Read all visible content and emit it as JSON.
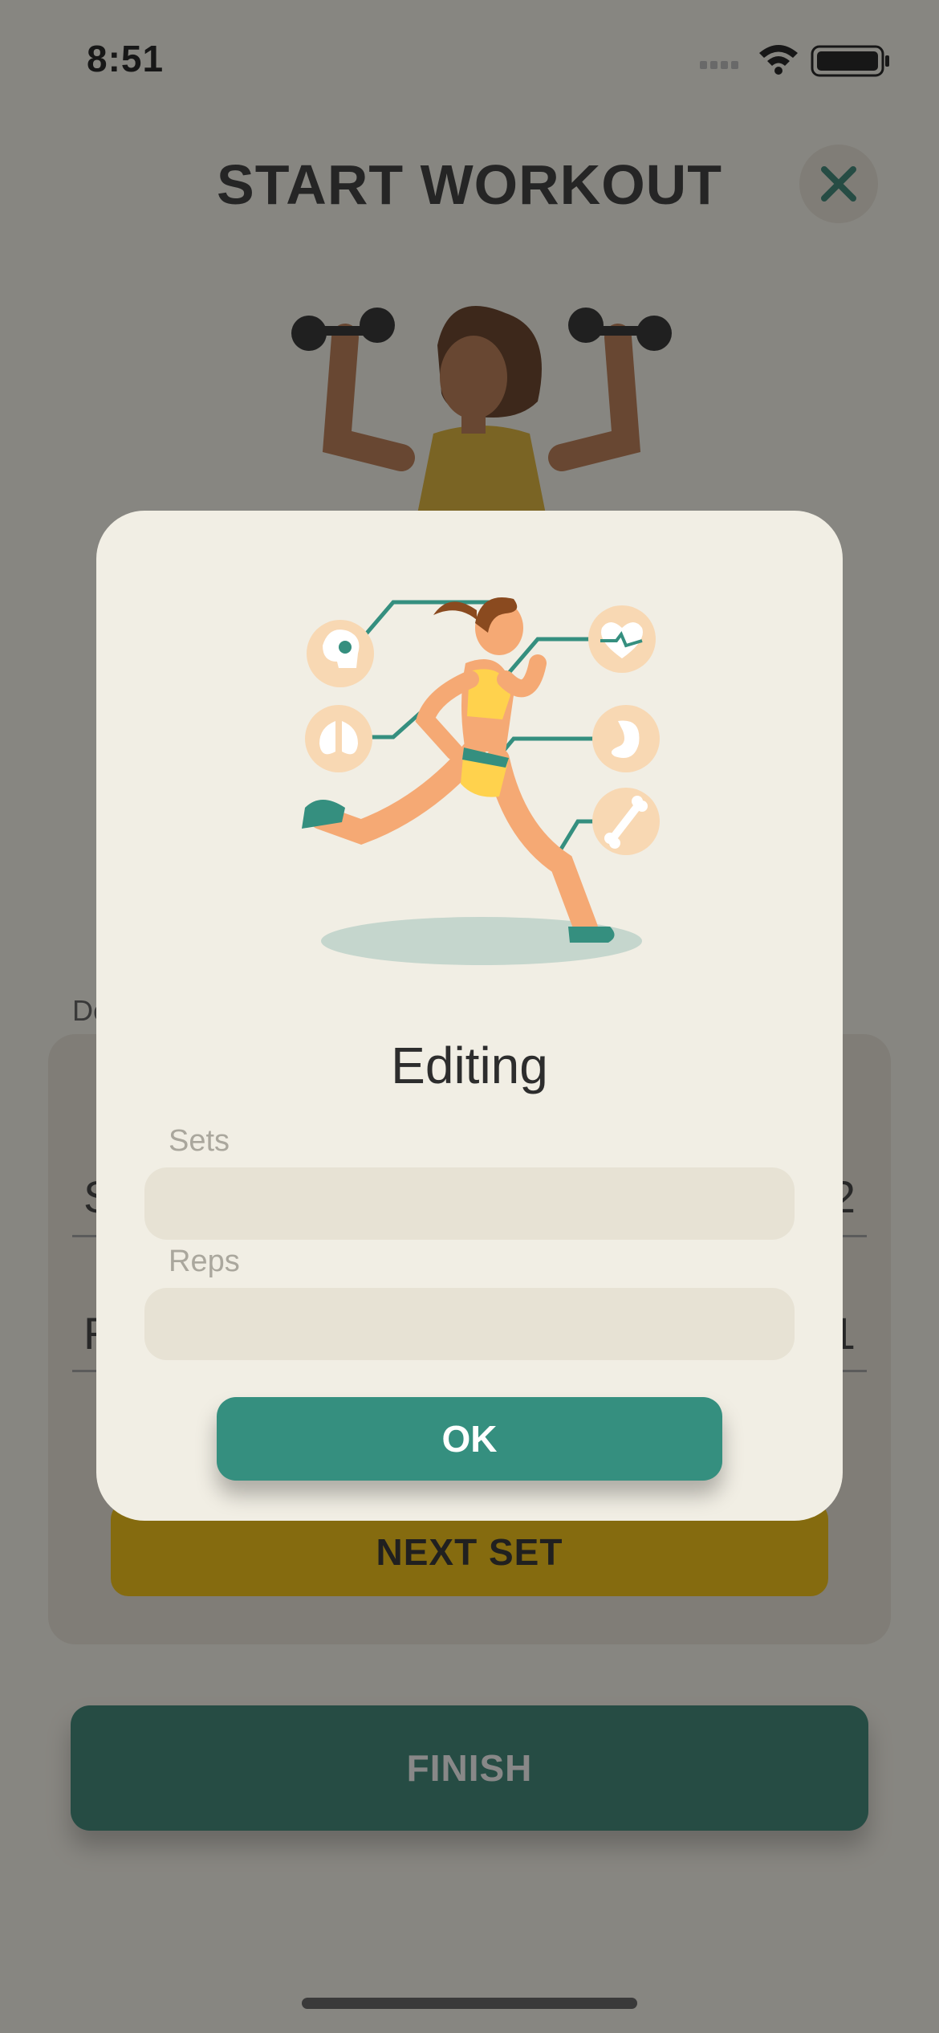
{
  "status_bar": {
    "time": "8:51",
    "icons": [
      "signal-icon",
      "wifi-icon",
      "battery-icon"
    ]
  },
  "header": {
    "title": "START WORKOUT",
    "close_icon": "close-icon"
  },
  "background": {
    "details_label": "De",
    "rows": [
      {
        "left_text": "S",
        "right_text": "2"
      },
      {
        "left_text": "R",
        "right_text": "1"
      }
    ],
    "next_set_label": "NEXT SET",
    "finish_label": "FINISH"
  },
  "modal": {
    "title": "Editing",
    "sets_label": "Sets",
    "sets_value": "",
    "reps_label": "Reps",
    "reps_value": "",
    "ok_label": "OK"
  },
  "colors": {
    "accent_teal": "#358f7f",
    "accent_yellow": "#ecb800",
    "finish_green": "#2e7a6b",
    "modal_background": "#f1eee4"
  }
}
